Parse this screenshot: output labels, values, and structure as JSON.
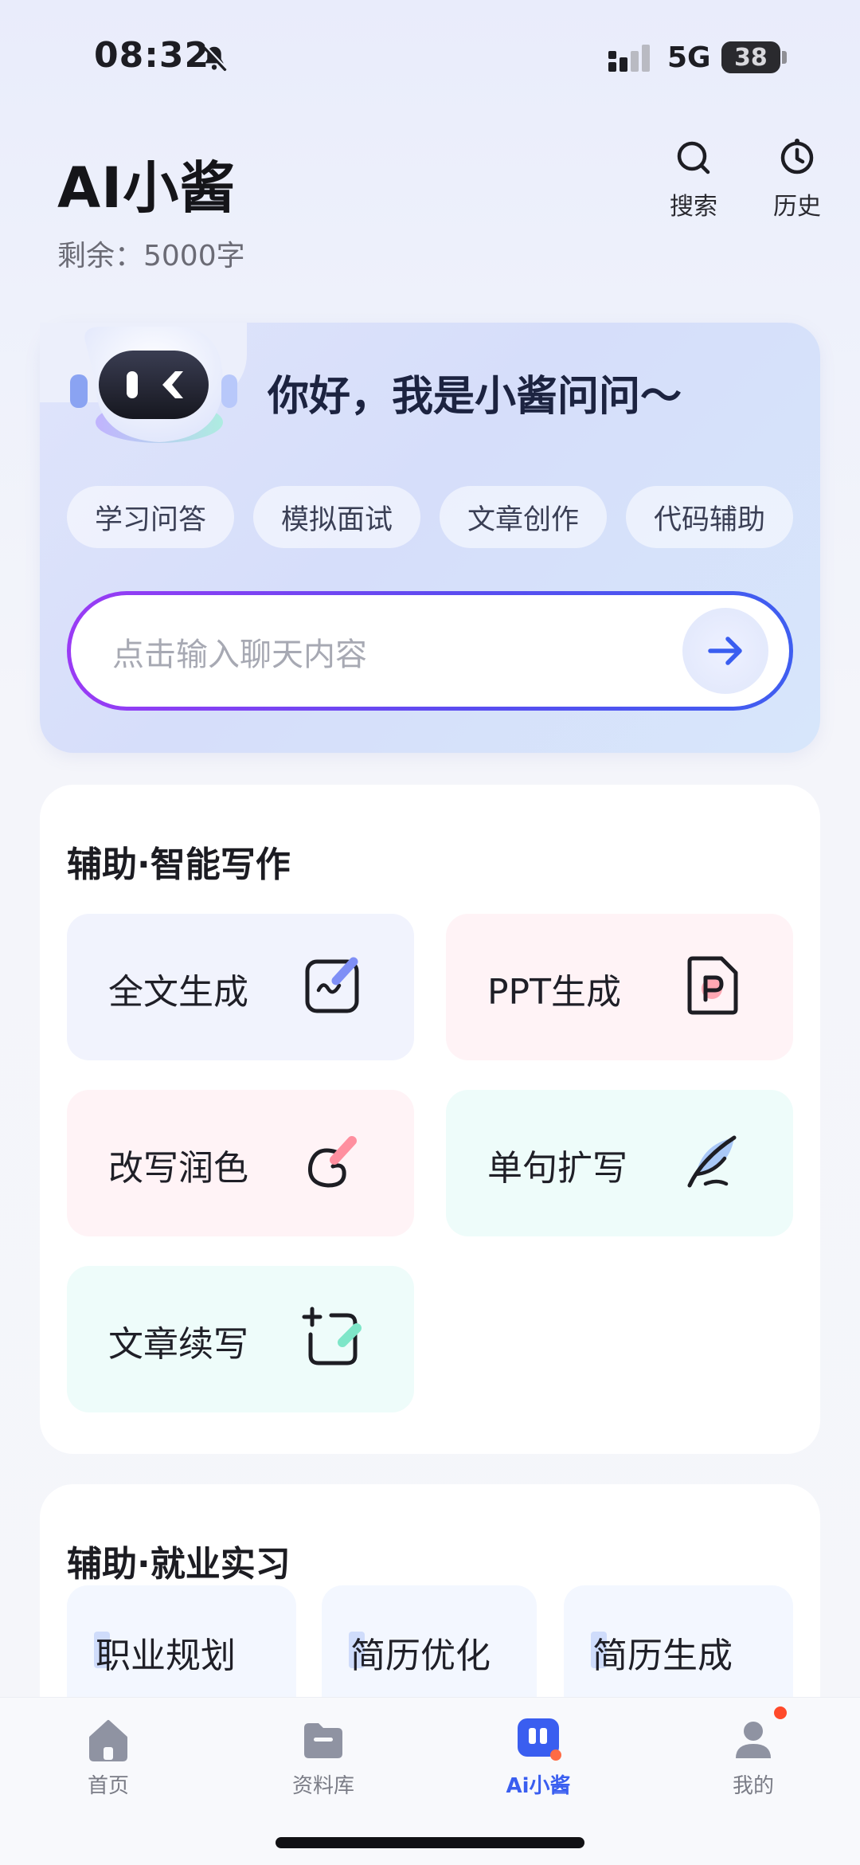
{
  "status_bar": {
    "time": "08:32",
    "network": "5G",
    "battery": "38"
  },
  "header": {
    "title": "AI小酱",
    "remaining": "剩余：5000字",
    "actions": [
      {
        "label": "搜索",
        "icon": "search-icon"
      },
      {
        "label": "历史",
        "icon": "history-icon"
      }
    ]
  },
  "hero": {
    "greeting": "你好，我是小酱问问～",
    "chips": [
      "学习问答",
      "模拟面试",
      "文章创作",
      "代码辅助"
    ],
    "input_placeholder": "点击输入聊天内容"
  },
  "writing_section": {
    "title": "辅助·智能写作",
    "tools": [
      {
        "label": "全文生成",
        "icon": "full-text-icon",
        "bg": "#f1f3fd"
      },
      {
        "label": "PPT生成",
        "icon": "ppt-icon",
        "bg": "#fff3f6"
      },
      {
        "label": "改写润色",
        "icon": "polish-icon",
        "bg": "#fff3f6"
      },
      {
        "label": "单句扩写",
        "icon": "feather-icon",
        "bg": "#eefcfa"
      },
      {
        "label": "文章续写",
        "icon": "continue-icon",
        "bg": "#eefcfa"
      }
    ]
  },
  "career_section": {
    "title": "辅助·就业实习",
    "tools": [
      "职业规划",
      "简历优化",
      "简历生成"
    ]
  },
  "bottom_nav": [
    {
      "label": "首页",
      "icon": "home-icon"
    },
    {
      "label": "资料库",
      "icon": "folder-icon"
    },
    {
      "label": "Ai小酱",
      "icon": "ai-chat-icon",
      "active": true
    },
    {
      "label": "我的",
      "icon": "profile-icon"
    }
  ],
  "colors": {
    "accent": "#3a5ef0",
    "gradient_start": "#9a3bf5",
    "notification": "#ff4a2a"
  }
}
